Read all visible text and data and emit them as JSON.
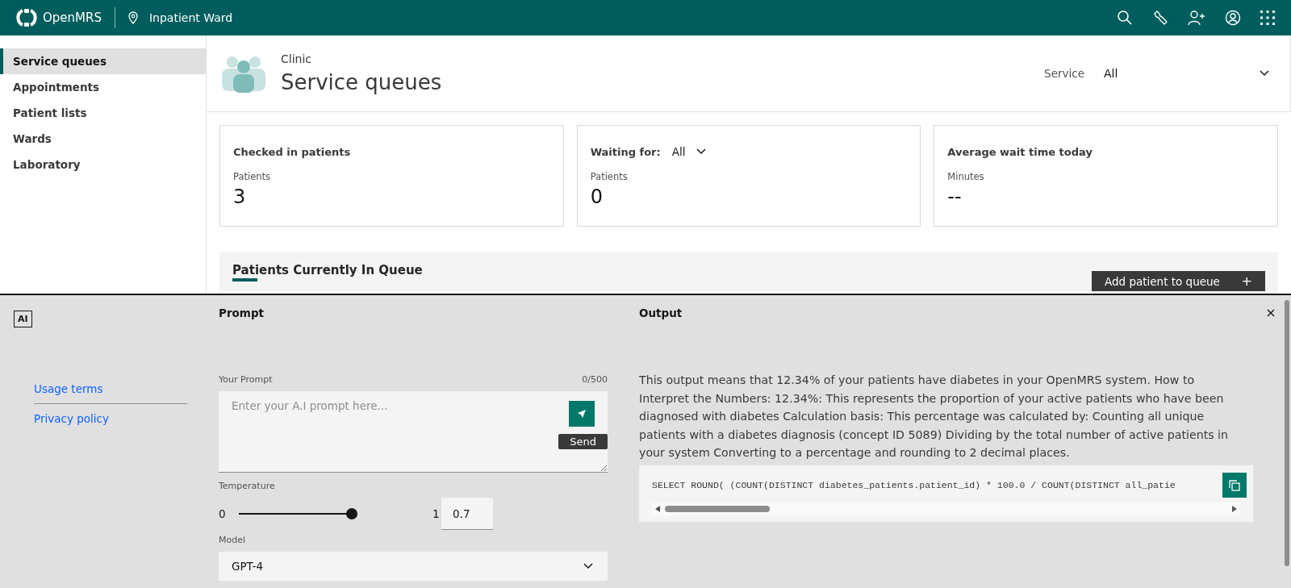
{
  "header": {
    "brand": "OpenMRS",
    "location": "Inpatient Ward"
  },
  "sidebar": {
    "items": [
      {
        "label": "Service queues",
        "selected": true
      },
      {
        "label": "Appointments",
        "selected": false
      },
      {
        "label": "Patient lists",
        "selected": false
      },
      {
        "label": "Wards",
        "selected": false
      },
      {
        "label": "Laboratory",
        "selected": false
      }
    ]
  },
  "page_header": {
    "subtitle": "Clinic",
    "title": "Service queues",
    "filter_label": "Service",
    "filter_value": "All"
  },
  "metrics": [
    {
      "kind": "plain",
      "title": "Checked in patients",
      "unit": "Patients",
      "value": "3"
    },
    {
      "kind": "dropdown",
      "title": "Waiting for:",
      "filter_value": "All",
      "unit": "Patients",
      "value": "0"
    },
    {
      "kind": "plain",
      "title": "Average wait time today",
      "unit": "Minutes",
      "value": "--"
    }
  ],
  "queue": {
    "tab": "Patients Currently In Queue",
    "add_button": "Add patient to queue",
    "add_icon": "+"
  },
  "ai_panel": {
    "badge": "AI",
    "links": [
      "Usage terms",
      "Privacy policy"
    ],
    "prompt": {
      "heading": "Prompt",
      "label": "Your Prompt",
      "counter": "0/500",
      "placeholder": "Enter your A.I prompt here...",
      "send_tooltip": "Send",
      "temperature": {
        "label": "Temperature",
        "min": "0",
        "max": "1",
        "level": 0.7,
        "value": "0.7"
      },
      "model": {
        "label": "Model",
        "value": "GPT-4"
      }
    },
    "output": {
      "heading": "Output",
      "text": "This output means that 12.34% of your patients have diabetes in your OpenMRS system. How to Interpret the Numbers: 12.34%: This represents the proportion of your active patients who have been diagnosed with diabetes Calculation basis: This percentage was calculated by: Counting all unique patients with a diabetes diagnosis (concept ID 5089) Dividing by the total number of active patients in your system Converting to a percentage and rounding to 2 decimal places.",
      "code": "SELECT ROUND( (COUNT(DISTINCT diabetes_patients.patient_id) * 100.0 / COUNT(DISTINCT all_patie"
    }
  }
}
